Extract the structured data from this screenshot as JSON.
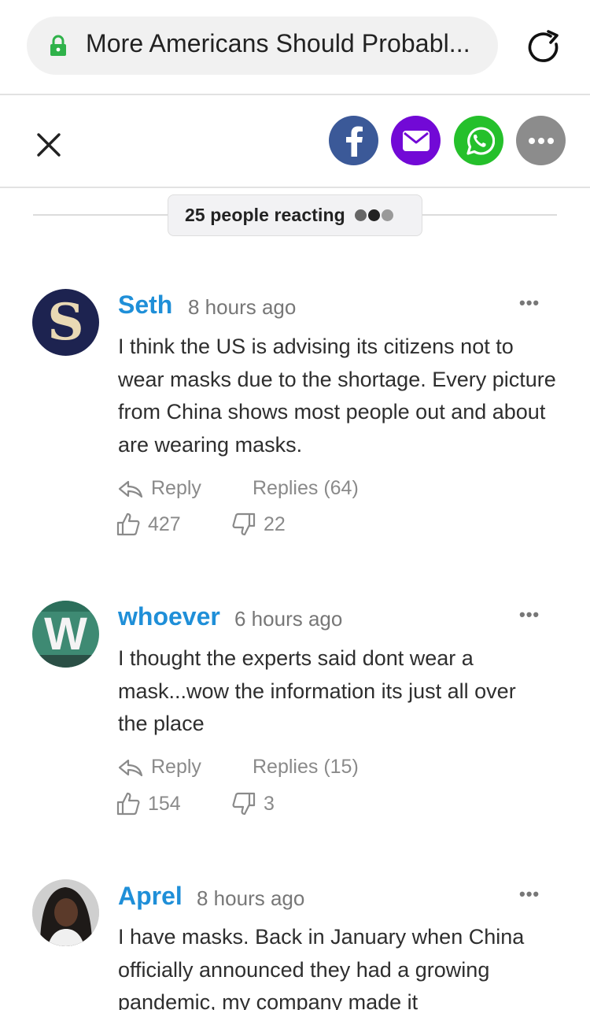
{
  "browser": {
    "url_title": "More Americans Should Probabl...",
    "lock_icon": "lock-icon",
    "reload_icon": "reload-icon"
  },
  "toolbar": {
    "close_icon": "close-icon",
    "share_buttons": [
      "facebook",
      "email",
      "whatsapp",
      "more"
    ],
    "colors": {
      "facebook": "#3b5998",
      "email": "#7209d6",
      "whatsapp": "#25c02b",
      "more": "#8c8c8c"
    }
  },
  "reacting": {
    "label": "25 people reacting"
  },
  "comments": [
    {
      "author": "Seth",
      "time": "8 hours ago",
      "body": "I think the US is advising its citizens not to wear masks due to the shortage. Every picture from China shows most people out and about are wearing masks.",
      "reply_label": "Reply",
      "replies_label": "Replies (64)",
      "likes": "427",
      "dislikes": "22",
      "avatar_letter": "S"
    },
    {
      "author": "whoever",
      "time": "6 hours ago",
      "body": "I thought the experts said dont wear a mask...wow the information its just all over the place",
      "reply_label": "Reply",
      "replies_label": "Replies (15)",
      "likes": "154",
      "dislikes": "3",
      "avatar_letter": "W"
    },
    {
      "author": "Aprel",
      "time": "8 hours ago",
      "body": "I have masks. Back in January when China officially announced they had a growing pandemic, my company made it"
    }
  ],
  "colors": {
    "accent": "#1f8fd8",
    "muted": "#8a8a8a"
  }
}
